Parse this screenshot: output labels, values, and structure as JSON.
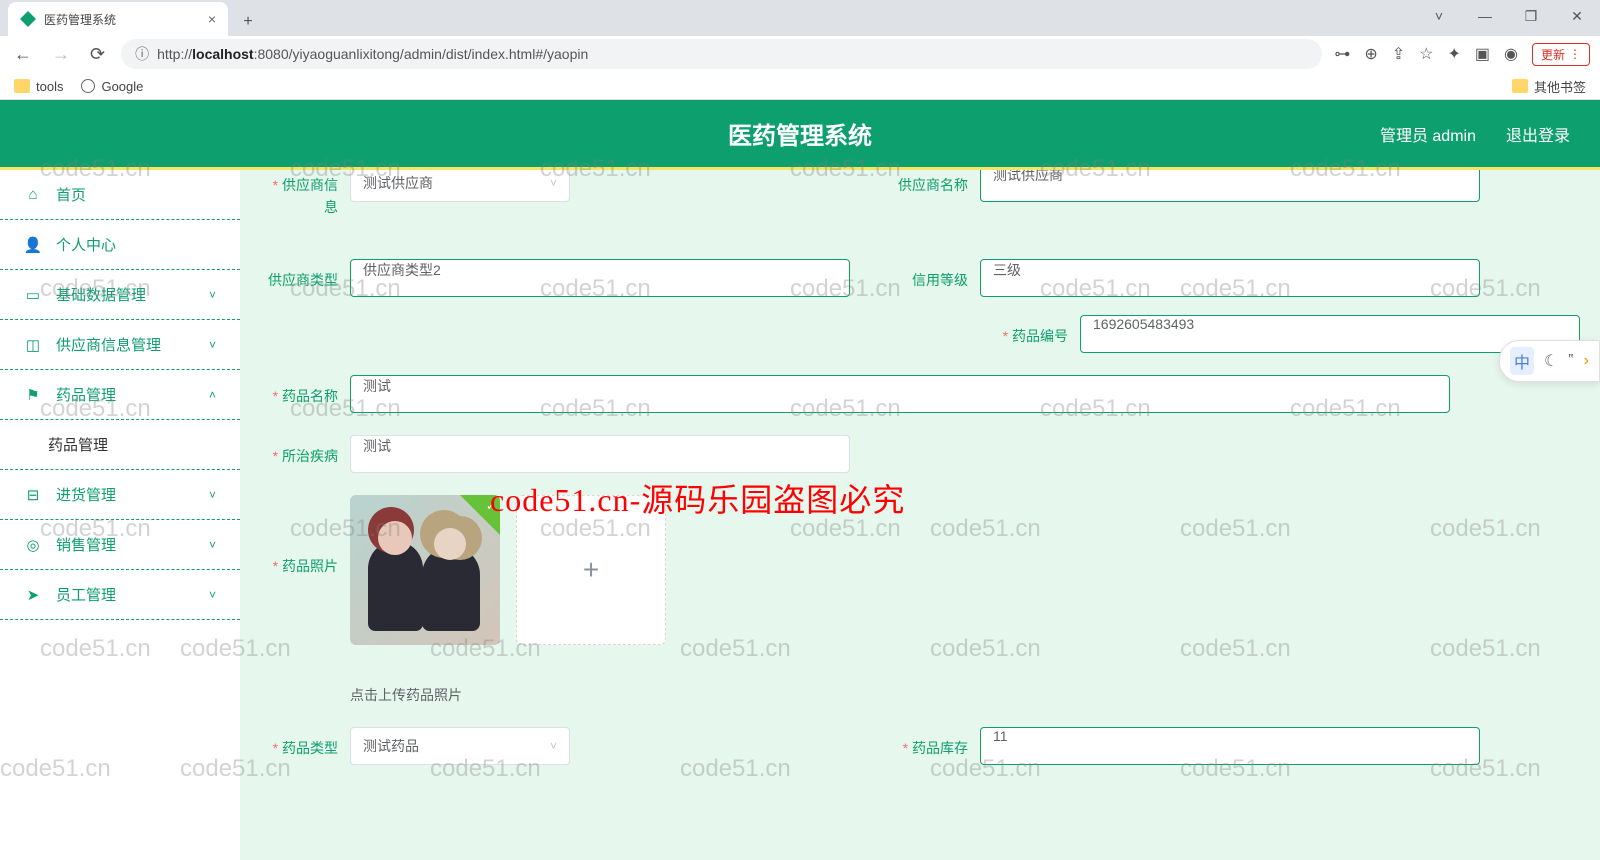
{
  "browser": {
    "tab_title": "医药管理系统",
    "url_prefix": "http://",
    "url_host": "localhost",
    "url_path": ":8080/yiyaoguanlixitong/admin/dist/index.html#/yaopin",
    "update_label": "更新",
    "bookmarks": {
      "tools": "tools",
      "google": "Google",
      "other": "其他书签"
    }
  },
  "header": {
    "title": "医药管理系统",
    "user": "管理员 admin",
    "logout": "退出登录"
  },
  "sidebar": {
    "home": "首页",
    "profile": "个人中心",
    "basedata": "基础数据管理",
    "supplier": "供应商信息管理",
    "medicine": "药品管理",
    "medicine_sub": "药品管理",
    "purchase": "进货管理",
    "sales": "销售管理",
    "staff": "员工管理"
  },
  "form": {
    "supplier_info_label": "供应商信息",
    "supplier_info_value": "测试供应商",
    "supplier_name_label": "供应商名称",
    "supplier_name_value": "测试供应商",
    "supplier_type_label": "供应商类型",
    "supplier_type_value": "供应商类型2",
    "credit_label": "信用等级",
    "credit_value": "三级",
    "code_label": "药品编号",
    "code_value": "1692605483493",
    "name_label": "药品名称",
    "name_value": "测试",
    "disease_label": "所治疾病",
    "disease_value": "测试",
    "photo_label": "药品照片",
    "upload_hint": "点击上传药品照片",
    "type_label": "药品类型",
    "type_value": "测试药品",
    "stock_label": "药品库存",
    "stock_value": "11"
  },
  "watermark": "code51.cn",
  "banner": "code51.cn-源码乐园盗图必究",
  "float": {
    "ime": "中"
  }
}
